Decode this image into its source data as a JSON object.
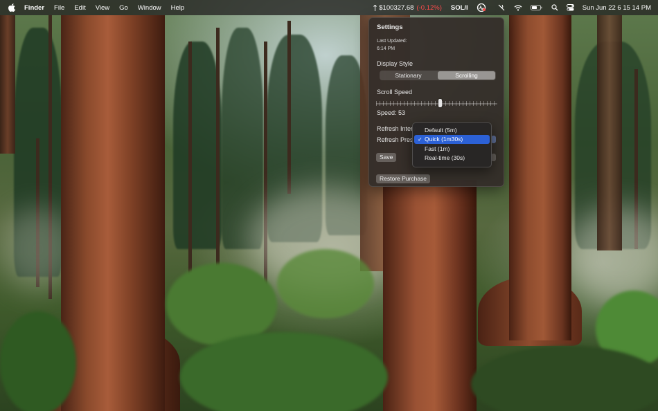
{
  "menubar": {
    "app_name": "Finder",
    "menus": [
      "File",
      "Edit",
      "View",
      "Go",
      "Window",
      "Help"
    ],
    "ticker_price": "$100327.68",
    "ticker_change": "(-0.12%)",
    "ticker_symbol": "SOL/I",
    "clock": "Sun Jun 22  6 15 14 PM",
    "icons": [
      "apple-icon",
      "trend-icon",
      "activity-icon",
      "mute-icon",
      "wifi-icon",
      "battery-icon",
      "search-icon",
      "control-center-icon"
    ]
  },
  "settings": {
    "title": "Settings",
    "last_updated_label": "Last Updated:",
    "last_updated_time": "6:14 PM",
    "display_style_label": "Display Style",
    "display_style_options": [
      "Stationary",
      "Scrolling"
    ],
    "display_style_selected": "Scrolling",
    "scroll_speed_label": "Scroll Speed",
    "scroll_speed_value": 53,
    "speed_text": "Speed: 53",
    "refresh_interval_label": "Refresh Interv",
    "refresh_preset_label": "Refresh Prese",
    "save_label": "Save",
    "restore_label": "Restore Purchase"
  },
  "refresh_dropdown": {
    "items": [
      "Default (5m)",
      "Quick (1m30s)",
      "Fast (1m)",
      "Real-time (30s)"
    ],
    "selected_index": 1
  },
  "colors": {
    "selection": "#2c61d6",
    "negative": "#ff4d4d"
  }
}
